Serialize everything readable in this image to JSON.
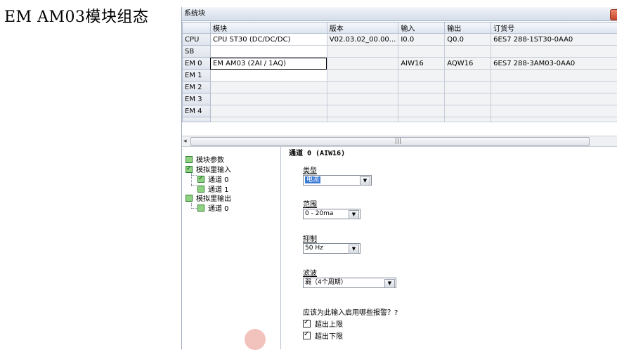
{
  "slide": {
    "title": "EM AM03模块组态"
  },
  "window": {
    "title": "系统块"
  },
  "table": {
    "headers": [
      "",
      "模块",
      "版本",
      "输入",
      "输出",
      "订货号"
    ],
    "rows": [
      {
        "slot": "CPU",
        "module": "CPU ST30 (DC/DC/DC)",
        "version": "V02.03.02_00.00...",
        "input": "I0.0",
        "output": "Q0.0",
        "order": "6ES7 288-1ST30-0AA0"
      },
      {
        "slot": "SB",
        "module": "",
        "version": "",
        "input": "",
        "output": "",
        "order": ""
      },
      {
        "slot": "EM 0",
        "module": "EM AM03 (2AI / 1AQ)",
        "version": "",
        "input": "AIW16",
        "output": "AQW16",
        "order": "6ES7 288-3AM03-0AA0"
      },
      {
        "slot": "EM 1",
        "module": "",
        "version": "",
        "input": "",
        "output": "",
        "order": ""
      },
      {
        "slot": "EM 2",
        "module": "",
        "version": "",
        "input": "",
        "output": "",
        "order": ""
      },
      {
        "slot": "EM 3",
        "module": "",
        "version": "",
        "input": "",
        "output": "",
        "order": ""
      },
      {
        "slot": "EM 4",
        "module": "",
        "version": "",
        "input": "",
        "output": "",
        "order": ""
      }
    ]
  },
  "scrollbar": {
    "left_arrow": "◂",
    "grip": "|||"
  },
  "tree": {
    "items": [
      {
        "label": "模块参数",
        "checked": false
      },
      {
        "label": "模拟里输入",
        "checked": true
      },
      {
        "label": "通道 0",
        "checked": true
      },
      {
        "label": "通道 1",
        "checked": false
      },
      {
        "label": "模拟里输出",
        "checked": false
      },
      {
        "label": "通道 0",
        "checked": false
      }
    ]
  },
  "panel": {
    "channel_title": "通道 0 (AIW16)",
    "type_label": "类型",
    "type_value": "电流",
    "range_label": "范围",
    "range_value": "0 - 20ma",
    "suppression_label": "抑制",
    "suppression_value": "50 Hz",
    "filter_label": "滤波",
    "filter_value": "弱（4个周期）",
    "alarm_question": "应该为此输入启用哪些报警？?",
    "alarm_upper": "超出上限",
    "alarm_lower": "超出下限"
  },
  "colors": {
    "selection": "#3d7bd6",
    "tree_check": "#8ed281",
    "close_button": "#c8452a"
  }
}
